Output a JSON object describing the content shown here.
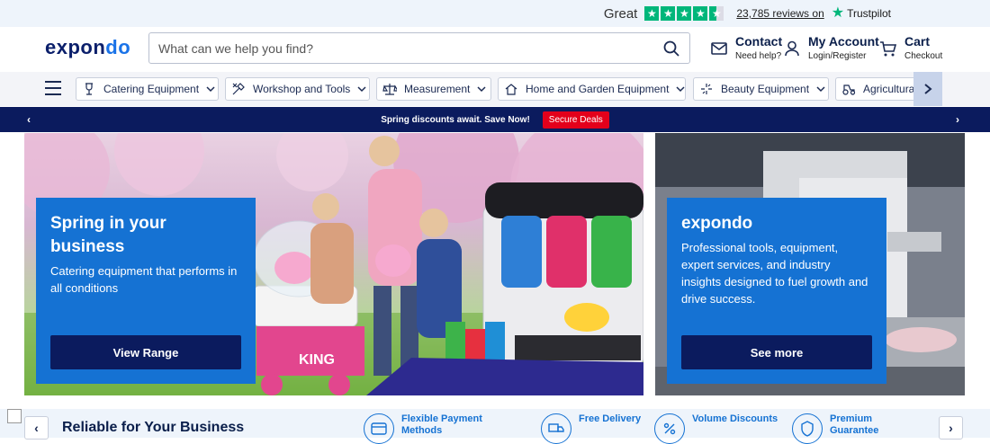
{
  "trustpilot": {
    "rating_word": "Great",
    "stars": 4.5,
    "reviews_link": "23,785 reviews on",
    "brand": "Trustpilot",
    "color": "#00b67a"
  },
  "header": {
    "logo_main": "expon",
    "logo_accent": "do",
    "search_placeholder": "What can we help you find?",
    "contact": {
      "label": "Contact",
      "sub": "Need help?"
    },
    "account": {
      "label": "My Account",
      "sub": "Login/Register"
    },
    "cart": {
      "label": "Cart",
      "sub": "Checkout"
    }
  },
  "categories": [
    {
      "label": "Catering Equipment",
      "icon": "catering-icon"
    },
    {
      "label": "Workshop and Tools",
      "icon": "tools-icon"
    },
    {
      "label": "Measurement",
      "icon": "scale-icon"
    },
    {
      "label": "Home and Garden Equipment",
      "icon": "house-icon"
    },
    {
      "label": "Beauty Equipment",
      "icon": "sparkle-icon"
    },
    {
      "label": "Agricultura",
      "icon": "tractor-icon"
    }
  ],
  "promo": {
    "text": "Spring discounts await. Save Now!",
    "button": "Secure Deals",
    "bg_color": "#0b1b5e",
    "button_color": "#e3001b"
  },
  "hero": {
    "left": {
      "title": "Spring in your business",
      "desc": "Catering equipment that performs in all conditions",
      "button": "View Range"
    },
    "right": {
      "title": "expondo",
      "desc": "Professional tools, equipment, expert services, and industry insights designed to fuel growth and drive success.",
      "button": "See more"
    },
    "card_color": "#1572d3"
  },
  "bottom": {
    "heading": "Reliable for Your Business",
    "features": [
      {
        "label": "Flexible Payment Methods",
        "icon": "payment-icon"
      },
      {
        "label": "Free Delivery",
        "icon": "delivery-icon"
      },
      {
        "label": "Volume Discounts",
        "icon": "discount-icon"
      },
      {
        "label": "Premium Guarantee",
        "icon": "guarantee-icon"
      }
    ]
  }
}
